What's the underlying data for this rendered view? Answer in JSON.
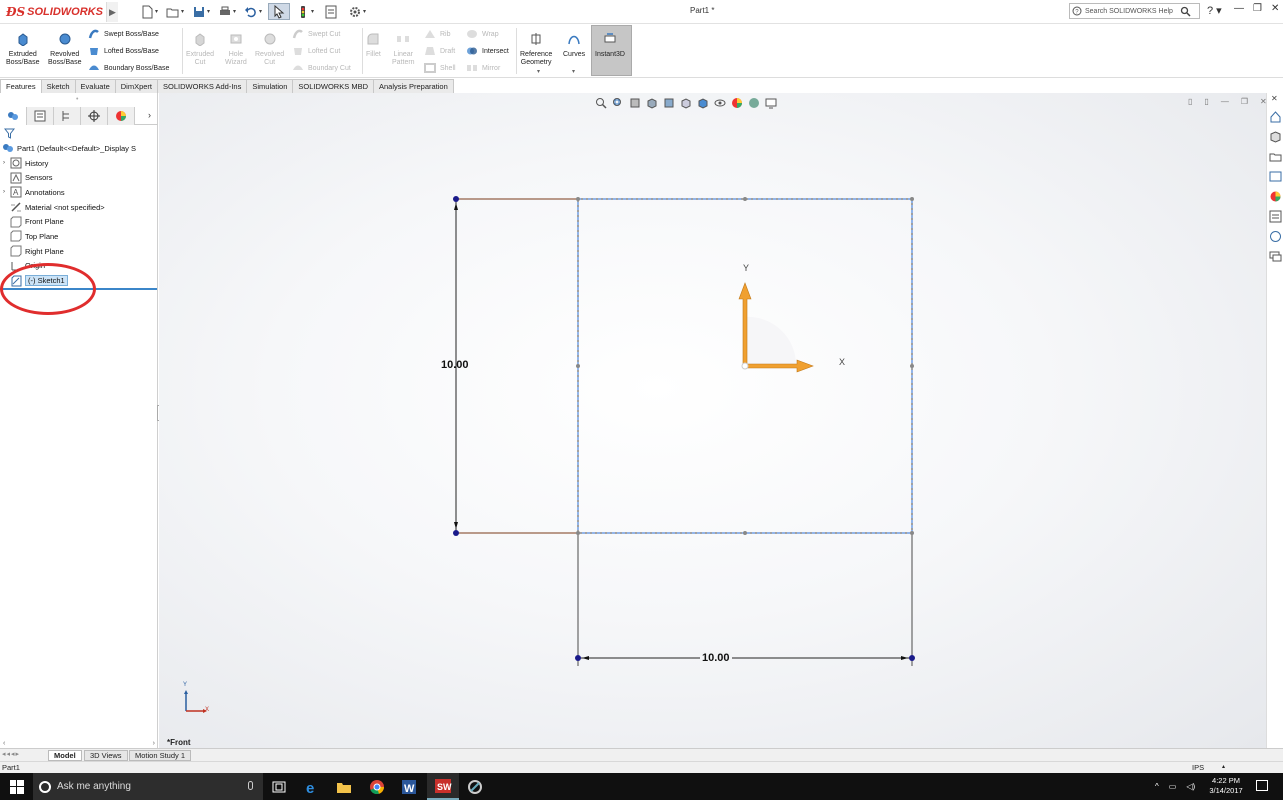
{
  "titlebar": {
    "logo_ds": "ƉS",
    "logo_text": "SOLIDWORKS",
    "document_title": "Part1 *",
    "help_search_placeholder": "Search SOLIDWORKS Help",
    "help_label": "?"
  },
  "command_manager": {
    "extruded_boss": "Extruded\nBoss/Base",
    "revolved_boss": "Revolved\nBoss/Base",
    "swept_boss": "Swept Boss/Base",
    "lofted_boss": "Lofted Boss/Base",
    "boundary_boss": "Boundary Boss/Base",
    "extruded_cut": "Extruded\nCut",
    "hole_wizard": "Hole\nWizard",
    "revolved_cut": "Revolved\nCut",
    "swept_cut": "Swept Cut",
    "lofted_cut": "Lofted Cut",
    "boundary_cut": "Boundary Cut",
    "fillet": "Fillet",
    "linear_pattern": "Linear\nPattern",
    "rib": "Rib",
    "draft": "Draft",
    "shell": "Shell",
    "wrap": "Wrap",
    "intersect": "Intersect",
    "mirror": "Mirror",
    "reference_geometry": "Reference\nGeometry",
    "curves": "Curves",
    "instant3d": "Instant3D"
  },
  "tabs": [
    "Features",
    "Sketch",
    "Evaluate",
    "DimXpert",
    "SOLIDWORKS Add-Ins",
    "Simulation",
    "SOLIDWORKS MBD",
    "Analysis Preparation"
  ],
  "tree": {
    "root": "Part1  (Default<<Default>_Display S",
    "items": [
      {
        "label": "History",
        "expander": "›"
      },
      {
        "label": "Sensors",
        "expander": ""
      },
      {
        "label": "Annotations",
        "expander": "›"
      },
      {
        "label": "Material <not specified>",
        "expander": ""
      },
      {
        "label": "Front Plane",
        "expander": ""
      },
      {
        "label": "Top Plane",
        "expander": ""
      },
      {
        "label": "Right Plane",
        "expander": ""
      },
      {
        "label": "Origin",
        "expander": ""
      },
      {
        "label": "(-) Sketch1",
        "expander": ""
      }
    ]
  },
  "graphics": {
    "dim_vertical": "10.00",
    "dim_horizontal": "10.00",
    "triad_y": "Y",
    "triad_x": "X",
    "mini_triad_y": "Y",
    "mini_triad_x": "X",
    "view_label": "*Front",
    "colors": {
      "sketch_line": "#4a4a4a",
      "construction": "#7a4a2a",
      "selection_box": "#2b6fd6",
      "triad": "#f0a030",
      "point": "#1a1a8a"
    }
  },
  "bottom_tabs": [
    "Model",
    "3D Views",
    "Motion Study 1"
  ],
  "status": {
    "left": "Part1",
    "units": "IPS"
  },
  "taskbar": {
    "search_placeholder": "Ask me anything",
    "time": "4:22 PM",
    "date": "3/14/2017"
  }
}
